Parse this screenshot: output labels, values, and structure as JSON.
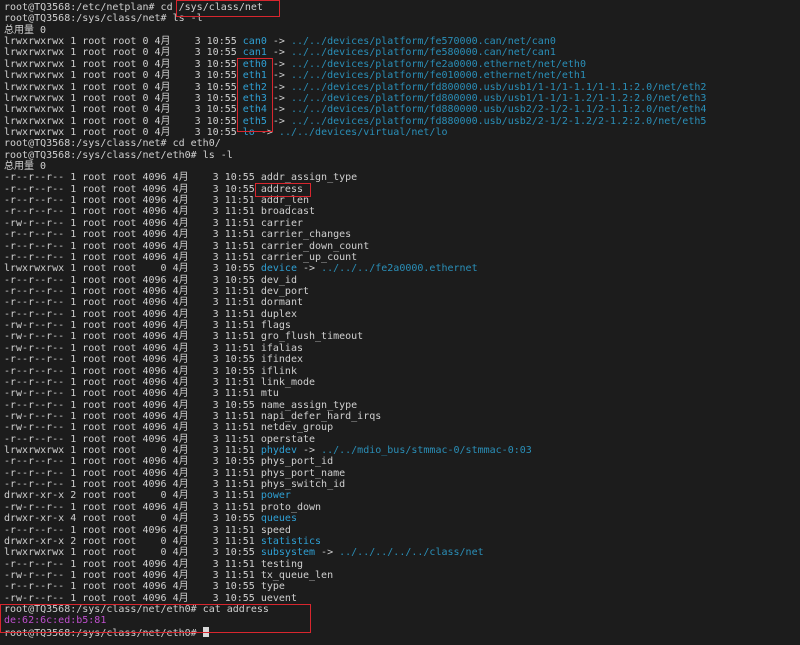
{
  "colors": {
    "background": "#1c1c1c",
    "text": "#cfcfcf",
    "link": "#2fa0d4",
    "mac": "#c04fcf",
    "highlight": "#d8262e"
  },
  "lines": [
    {
      "kind": "cmd",
      "prompt": "root@TQ3568:/etc/netplan# ",
      "command": "cd /sys/class/net"
    },
    {
      "kind": "cmd",
      "prompt": "root@TQ3568:/sys/class/net# ",
      "command": "ls -l"
    },
    {
      "kind": "text",
      "text": "总用量 0"
    },
    {
      "kind": "entry",
      "meta": "lrwxrwxrwx 1 root root 0 4月    3 10:55 ",
      "name": "can0",
      "type": "link",
      "target": "../../devices/platform/fe570000.can/net/can0"
    },
    {
      "kind": "entry",
      "meta": "lrwxrwxrwx 1 root root 0 4月    3 10:55 ",
      "name": "can1",
      "type": "link",
      "target": "../../devices/platform/fe580000.can/net/can1"
    },
    {
      "kind": "entry",
      "meta": "lrwxrwxrwx 1 root root 0 4月    3 10:55 ",
      "name": "eth0",
      "type": "link",
      "target": "../../devices/platform/fe2a0000.ethernet/net/eth0"
    },
    {
      "kind": "entry",
      "meta": "lrwxrwxrwx 1 root root 0 4月    3 10:55 ",
      "name": "eth1",
      "type": "link",
      "target": "../../devices/platform/fe010000.ethernet/net/eth1"
    },
    {
      "kind": "entry",
      "meta": "lrwxrwxrwx 1 root root 0 4月    3 10:55 ",
      "name": "eth2",
      "type": "link",
      "target": "../../devices/platform/fd800000.usb/usb1/1-1/1-1.1/1-1.1:2.0/net/eth2"
    },
    {
      "kind": "entry",
      "meta": "lrwxrwxrwx 1 root root 0 4月    3 10:55 ",
      "name": "eth3",
      "type": "link",
      "target": "../../devices/platform/fd800000.usb/usb1/1-1/1-1.2/1-1.2:2.0/net/eth3"
    },
    {
      "kind": "entry",
      "meta": "lrwxrwxrwx 1 root root 0 4月    3 10:55 ",
      "name": "eth4",
      "type": "link",
      "target": "../../devices/platform/fd880000.usb/usb2/2-1/2-1.1/2-1.1:2.0/net/eth4"
    },
    {
      "kind": "entry",
      "meta": "lrwxrwxrwx 1 root root 0 4月    3 10:55 ",
      "name": "eth5",
      "type": "link",
      "target": "../../devices/platform/fd880000.usb/usb2/2-1/2-1.2/2-1.2:2.0/net/eth5"
    },
    {
      "kind": "entry",
      "meta": "lrwxrwxrwx 1 root root 0 4月    3 10:55 ",
      "name": "lo",
      "type": "link",
      "target": "../../devices/virtual/net/lo"
    },
    {
      "kind": "cmd",
      "prompt": "root@TQ3568:/sys/class/net# ",
      "command": "cd eth0/"
    },
    {
      "kind": "cmd",
      "prompt": "root@TQ3568:/sys/class/net/eth0# ",
      "command": "ls -l"
    },
    {
      "kind": "text",
      "text": "总用量 0"
    },
    {
      "kind": "entry",
      "meta": "-r--r--r-- 1 root root 4096 4月    3 10:55 ",
      "name": "addr_assign_type",
      "type": "file"
    },
    {
      "kind": "entry",
      "meta": "-r--r--r-- 1 root root 4096 4月    3 10:55 ",
      "name": "address",
      "type": "file"
    },
    {
      "kind": "entry",
      "meta": "-r--r--r-- 1 root root 4096 4月    3 11:51 ",
      "name": "addr_len",
      "type": "file"
    },
    {
      "kind": "entry",
      "meta": "-r--r--r-- 1 root root 4096 4月    3 11:51 ",
      "name": "broadcast",
      "type": "file"
    },
    {
      "kind": "entry",
      "meta": "-rw-r--r-- 1 root root 4096 4月    3 11:51 ",
      "name": "carrier",
      "type": "file"
    },
    {
      "kind": "entry",
      "meta": "-r--r--r-- 1 root root 4096 4月    3 11:51 ",
      "name": "carrier_changes",
      "type": "file"
    },
    {
      "kind": "entry",
      "meta": "-r--r--r-- 1 root root 4096 4月    3 11:51 ",
      "name": "carrier_down_count",
      "type": "file"
    },
    {
      "kind": "entry",
      "meta": "-r--r--r-- 1 root root 4096 4月    3 11:51 ",
      "name": "carrier_up_count",
      "type": "file"
    },
    {
      "kind": "entry",
      "meta": "lrwxrwxrwx 1 root root    0 4月    3 10:55 ",
      "name": "device",
      "type": "link",
      "target": "../../../fe2a0000.ethernet"
    },
    {
      "kind": "entry",
      "meta": "-r--r--r-- 1 root root 4096 4月    3 10:55 ",
      "name": "dev_id",
      "type": "file"
    },
    {
      "kind": "entry",
      "meta": "-r--r--r-- 1 root root 4096 4月    3 11:51 ",
      "name": "dev_port",
      "type": "file"
    },
    {
      "kind": "entry",
      "meta": "-r--r--r-- 1 root root 4096 4月    3 11:51 ",
      "name": "dormant",
      "type": "file"
    },
    {
      "kind": "entry",
      "meta": "-r--r--r-- 1 root root 4096 4月    3 11:51 ",
      "name": "duplex",
      "type": "file"
    },
    {
      "kind": "entry",
      "meta": "-rw-r--r-- 1 root root 4096 4月    3 11:51 ",
      "name": "flags",
      "type": "file"
    },
    {
      "kind": "entry",
      "meta": "-rw-r--r-- 1 root root 4096 4月    3 11:51 ",
      "name": "gro_flush_timeout",
      "type": "file"
    },
    {
      "kind": "entry",
      "meta": "-rw-r--r-- 1 root root 4096 4月    3 11:51 ",
      "name": "ifalias",
      "type": "file"
    },
    {
      "kind": "entry",
      "meta": "-r--r--r-- 1 root root 4096 4月    3 10:55 ",
      "name": "ifindex",
      "type": "file"
    },
    {
      "kind": "entry",
      "meta": "-r--r--r-- 1 root root 4096 4月    3 10:55 ",
      "name": "iflink",
      "type": "file"
    },
    {
      "kind": "entry",
      "meta": "-r--r--r-- 1 root root 4096 4月    3 11:51 ",
      "name": "link_mode",
      "type": "file"
    },
    {
      "kind": "entry",
      "meta": "-rw-r--r-- 1 root root 4096 4月    3 11:51 ",
      "name": "mtu",
      "type": "file"
    },
    {
      "kind": "entry",
      "meta": "-r--r--r-- 1 root root 4096 4月    3 10:55 ",
      "name": "name_assign_type",
      "type": "file"
    },
    {
      "kind": "entry",
      "meta": "-rw-r--r-- 1 root root 4096 4月    3 11:51 ",
      "name": "napi_defer_hard_irqs",
      "type": "file"
    },
    {
      "kind": "entry",
      "meta": "-rw-r--r-- 1 root root 4096 4月    3 11:51 ",
      "name": "netdev_group",
      "type": "file"
    },
    {
      "kind": "entry",
      "meta": "-r--r--r-- 1 root root 4096 4月    3 11:51 ",
      "name": "operstate",
      "type": "file"
    },
    {
      "kind": "entry",
      "meta": "lrwxrwxrwx 1 root root    0 4月    3 11:51 ",
      "name": "phydev",
      "type": "link",
      "target": "../../mdio_bus/stmmac-0/stmmac-0:03"
    },
    {
      "kind": "entry",
      "meta": "-r--r--r-- 1 root root 4096 4月    3 10:55 ",
      "name": "phys_port_id",
      "type": "file"
    },
    {
      "kind": "entry",
      "meta": "-r--r--r-- 1 root root 4096 4月    3 11:51 ",
      "name": "phys_port_name",
      "type": "file"
    },
    {
      "kind": "entry",
      "meta": "-r--r--r-- 1 root root 4096 4月    3 11:51 ",
      "name": "phys_switch_id",
      "type": "file"
    },
    {
      "kind": "entry",
      "meta": "drwxr-xr-x 2 root root    0 4月    3 11:51 ",
      "name": "power",
      "type": "dir"
    },
    {
      "kind": "entry",
      "meta": "-rw-r--r-- 1 root root 4096 4月    3 11:51 ",
      "name": "proto_down",
      "type": "file"
    },
    {
      "kind": "entry",
      "meta": "drwxr-xr-x 4 root root    0 4月    3 10:55 ",
      "name": "queues",
      "type": "dir"
    },
    {
      "kind": "entry",
      "meta": "-r--r--r-- 1 root root 4096 4月    3 11:51 ",
      "name": "speed",
      "type": "file"
    },
    {
      "kind": "entry",
      "meta": "drwxr-xr-x 2 root root    0 4月    3 11:51 ",
      "name": "statistics",
      "type": "dir"
    },
    {
      "kind": "entry",
      "meta": "lrwxrwxrwx 1 root root    0 4月    3 10:55 ",
      "name": "subsystem",
      "type": "link",
      "target": "../../../../../class/net"
    },
    {
      "kind": "entry",
      "meta": "-r--r--r-- 1 root root 4096 4月    3 11:51 ",
      "name": "testing",
      "type": "file"
    },
    {
      "kind": "entry",
      "meta": "-rw-r--r-- 1 root root 4096 4月    3 11:51 ",
      "name": "tx_queue_len",
      "type": "file"
    },
    {
      "kind": "entry",
      "meta": "-r--r--r-- 1 root root 4096 4月    3 10:55 ",
      "name": "type",
      "type": "file"
    },
    {
      "kind": "entry",
      "meta": "-rw-r--r-- 1 root root 4096 4月    3 10:55 ",
      "name": "uevent",
      "type": "file"
    },
    {
      "kind": "cmd",
      "prompt": "root@TQ3568:/sys/class/net/eth0# ",
      "command": "cat address"
    },
    {
      "kind": "mac",
      "text": "de:62:6c:ed:b5:81"
    },
    {
      "kind": "cmd",
      "prompt": "root@TQ3568:/sys/class/net/eth0# ",
      "command": "",
      "cursor": true
    }
  ],
  "arrow": " -> "
}
